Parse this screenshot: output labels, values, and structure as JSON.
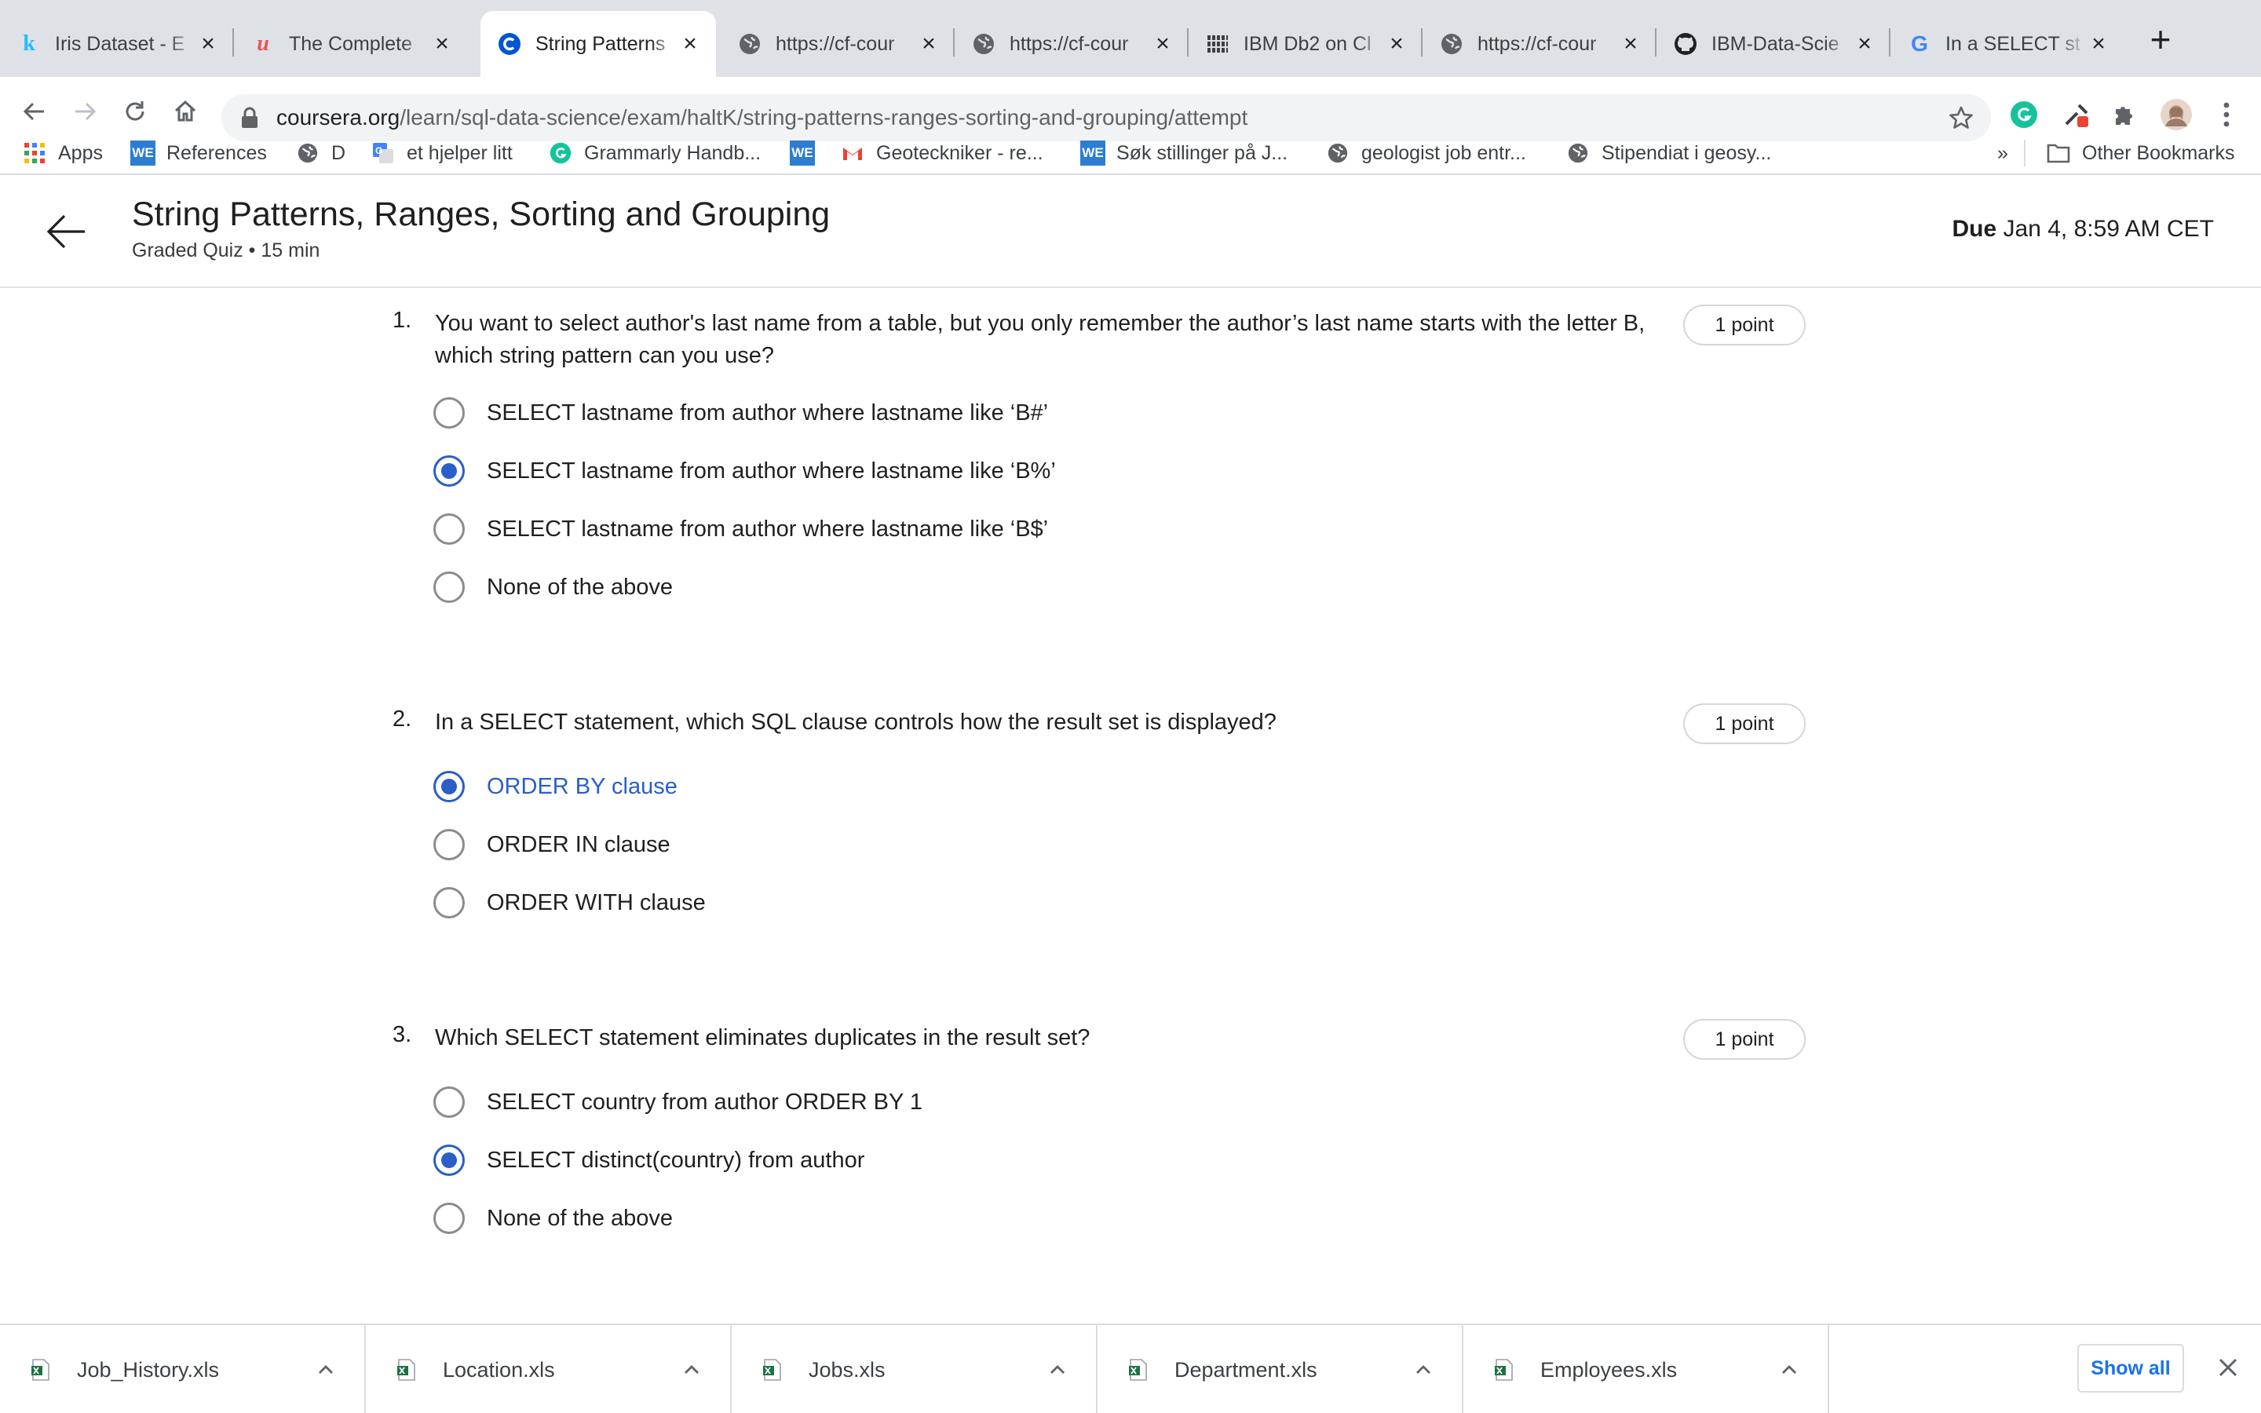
{
  "tabs": [
    {
      "title": "Iris Dataset - E",
      "icon": "kaggle-icon",
      "favicon_text": "k",
      "favicon_color": "#20beff"
    },
    {
      "title": "The Complete",
      "icon": "udemy-icon",
      "favicon_text": "u",
      "favicon_color": "#ec5252"
    },
    {
      "title": "String Patterns",
      "icon": "coursera-icon",
      "favicon_text": "C",
      "favicon_color": "#0056d2",
      "active": true
    },
    {
      "title": "https://cf-cour",
      "icon": "globe-icon"
    },
    {
      "title": "https://cf-cour",
      "icon": "globe-icon"
    },
    {
      "title": "IBM Db2 on Cl",
      "icon": "ibm-icon"
    },
    {
      "title": "https://cf-cour",
      "icon": "globe-icon"
    },
    {
      "title": "IBM-Data-Scie",
      "icon": "github-icon"
    },
    {
      "title": "In a SELECT st",
      "icon": "google-icon",
      "favicon_text": "G",
      "favicon_color": "#4285f4"
    }
  ],
  "address_bar": {
    "host": "coursera.org",
    "path": "/learn/sql-data-science/exam/haltK/string-patterns-ranges-sorting-and-grouping/attempt"
  },
  "bookmarks": [
    {
      "label": "Apps",
      "icon": "apps-grid-icon"
    },
    {
      "label": "References",
      "icon": "we-icon"
    },
    {
      "label": "D",
      "icon": "globe-icon"
    },
    {
      "label": "et hjelper litt",
      "icon": "translate-icon"
    },
    {
      "label": "Grammarly Handb...",
      "icon": "grammarly-icon"
    },
    {
      "label": "",
      "icon": "we-icon"
    },
    {
      "label": "Geoteckniker - re...",
      "icon": "gmail-icon"
    },
    {
      "label": "Søk stillinger på J...",
      "icon": "we-icon"
    },
    {
      "label": "geologist job entr...",
      "icon": "globe-icon"
    },
    {
      "label": "Stipendiat i geosy...",
      "icon": "globe-icon"
    }
  ],
  "bookmarks_overflow": "»",
  "other_bookmarks": "Other Bookmarks",
  "header": {
    "title": "String Patterns, Ranges, Sorting and Grouping",
    "subtitle": "Graded Quiz • 15 min",
    "due_label": "Due",
    "due_value": "Jan 4, 8:59 AM CET"
  },
  "questions": [
    {
      "number": "1.",
      "text": "You want to select author's last name from a table, but you only remember  the author’s last name starts with the letter B, which string pattern  can you use?",
      "points": "1 point",
      "options": [
        {
          "label": "SELECT lastname from author where lastname like ‘B#’",
          "selected": false
        },
        {
          "label": "SELECT lastname from author where lastname like ‘B%’",
          "selected": true
        },
        {
          "label": "SELECT lastname from author where lastname like ‘B$’",
          "selected": false
        },
        {
          "label": "None of the above",
          "selected": false
        }
      ]
    },
    {
      "number": "2.",
      "text": "In a SELECT statement, which SQL clause controls how the result set is displayed?",
      "points": "1 point",
      "options": [
        {
          "label": "ORDER BY clause",
          "selected": true
        },
        {
          "label": "ORDER IN clause",
          "selected": false
        },
        {
          "label": "ORDER WITH clause",
          "selected": false
        }
      ]
    },
    {
      "number": "3.",
      "text": "Which SELECT statement eliminates duplicates in the result set?",
      "points": "1 point",
      "options": [
        {
          "label": "SELECT country from author ORDER BY 1",
          "selected": false
        },
        {
          "label": "SELECT distinct(country) from author",
          "selected": true
        },
        {
          "label": "None of the above",
          "selected": false
        }
      ]
    }
  ],
  "downloads": [
    {
      "filename": "Job_History.xls",
      "icon": "excel-file-icon"
    },
    {
      "filename": "Location.xls",
      "icon": "excel-file-icon"
    },
    {
      "filename": "Jobs.xls",
      "icon": "excel-file-icon"
    },
    {
      "filename": "Department.xls",
      "icon": "excel-file-icon"
    },
    {
      "filename": "Employees.xls",
      "icon": "excel-file-icon"
    }
  ],
  "show_all_label": "Show all",
  "colors": {
    "accent_blue": "#2a5ec8",
    "tabstrip_bg": "#dee1e6",
    "omnibox_bg": "#f1f3f4"
  }
}
